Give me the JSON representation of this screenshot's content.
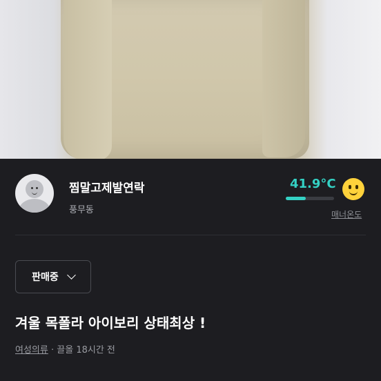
{
  "seller": {
    "nickname": "찜말고제발연락",
    "location": "풍무동",
    "temperature": "41.9°C",
    "temperature_level": 0.419,
    "manner_label": "매너온도",
    "accent_color": "#34d1c4"
  },
  "product": {
    "status": "판매중",
    "title": "겨울 목폴라 아이보리 상태최상 !",
    "category": "여성의류",
    "separator": "·",
    "time": "끌올 18시간 전"
  },
  "icons": {
    "avatar": "default-profile-avatar",
    "manner_face": "smiley-face-icon",
    "dropdown": "chevron-down-icon"
  }
}
